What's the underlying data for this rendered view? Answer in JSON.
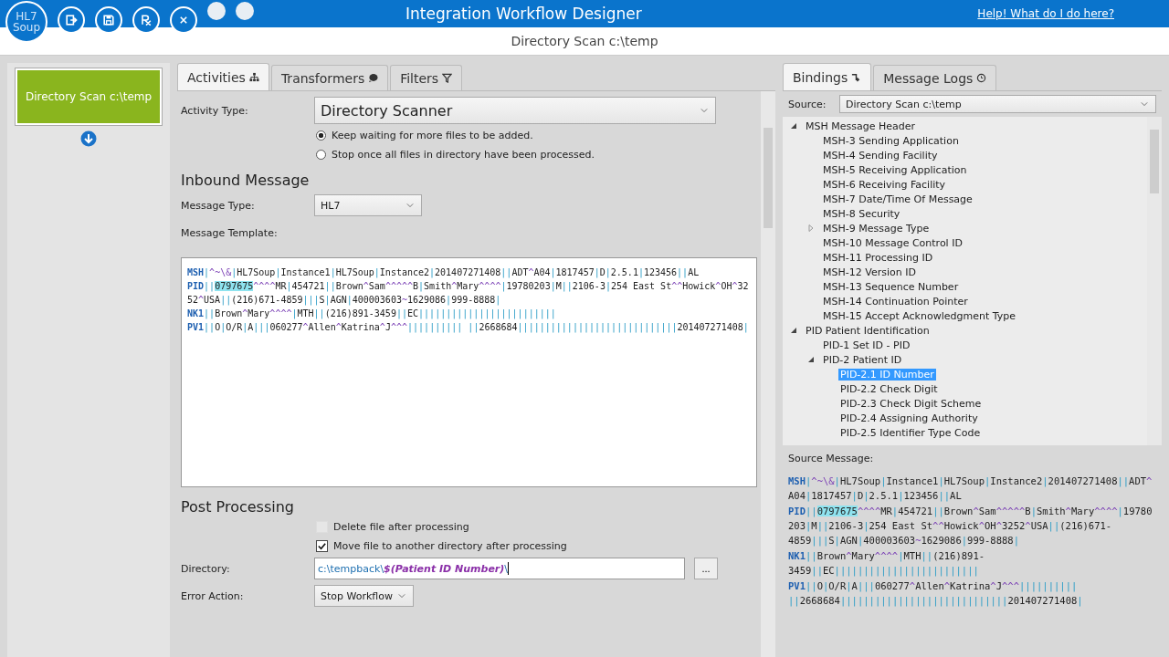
{
  "window": {
    "logo": [
      "HL7",
      "Soup"
    ],
    "title": "Integration Workflow Designer",
    "help_link": "Help!  What do I do here?",
    "subtitle": "Directory Scan c:\\temp",
    "toolbar": [
      {
        "kind": "exit",
        "disabled": false
      },
      {
        "kind": "save",
        "disabled": false
      },
      {
        "kind": "rx",
        "disabled": false
      },
      {
        "kind": "close",
        "disabled": false
      },
      {
        "kind": "blank",
        "disabled": true
      },
      {
        "kind": "blank",
        "disabled": true
      }
    ]
  },
  "workflow": {
    "activities": [
      {
        "label": "Directory Scan c:\\temp",
        "selected": true
      }
    ]
  },
  "editor": {
    "tabs": [
      {
        "label": "Activities",
        "selected": true
      },
      {
        "label": "Transformers",
        "selected": false
      },
      {
        "label": "Filters",
        "selected": false
      }
    ],
    "activity_type": {
      "label": "Activity Type:",
      "value": "Directory Scanner"
    },
    "scan_options": [
      {
        "label": "Keep waiting for more files to be added.",
        "selected": true
      },
      {
        "label": "Stop once all files in directory have been processed.",
        "selected": false
      }
    ],
    "inbound_heading": "Inbound Message",
    "message_type": {
      "label": "Message Type:",
      "value": "HL7"
    },
    "template_label": "Message Template:",
    "template": [
      {
        "name": "MSH",
        "parts": [
          {
            "kind": "text",
            "text": "|^~\\&|HL7Soup|Instance1|HL7Soup|Instance2|201407271408||ADT^A04|1817457|D|2.5.1|123456||AL"
          }
        ]
      },
      {
        "name": "PID",
        "parts": [
          {
            "kind": "text",
            "text": "||"
          },
          {
            "kind": "highlight",
            "text": "0797675"
          },
          {
            "kind": "text",
            "text": "^^^^MR|454721||Brown^Sam^^^^^B|Smith^Mary^^^^|19780203|M||2106-3|254 East St^^Howick^OH^3252^USA||(216)671-4859|||S|AGN|400003603~1629086|999-8888|"
          }
        ]
      },
      {
        "name": "NK1",
        "parts": [
          {
            "kind": "text",
            "text": "||Brown^Mary^^^^|MTH||(216)891-3459||EC|||||||||||||||||||||||||"
          }
        ]
      },
      {
        "name": "PV1",
        "parts": [
          {
            "kind": "text",
            "text": "||O|O/R|A|||060277^Allen^Katrina^J^^^|||||||||| ||2668684|||||||||||||||||||||||||||||201407271408|"
          }
        ]
      }
    ],
    "post_heading": "Post Processing",
    "post_options": [
      {
        "label": "Delete file after processing",
        "checked": false,
        "disabled": true
      },
      {
        "label": "Move file to another directory after processing",
        "checked": true,
        "disabled": false
      }
    ],
    "directory": {
      "label": "Directory:",
      "parts": [
        {
          "kind": "text",
          "text": "c:\\tempback\\"
        },
        {
          "kind": "variable",
          "text": "$(Patient ID Number)"
        },
        {
          "kind": "text",
          "text": "\\"
        }
      ],
      "browse": "..."
    },
    "error_action": {
      "label": "Error Action:",
      "value": "Stop Workflow"
    }
  },
  "bindings": {
    "tabs": [
      {
        "label": "Bindings",
        "selected": true
      },
      {
        "label": "Message Logs",
        "selected": false
      }
    ],
    "source": {
      "label": "Source:",
      "value": "Directory Scan c:\\temp"
    },
    "tree": [
      {
        "label": "MSH Message Header",
        "expanded": true,
        "selected": false,
        "children": [
          {
            "label": "MSH-3 Sending Application",
            "selected": false
          },
          {
            "label": "MSH-4 Sending Facility",
            "selected": false
          },
          {
            "label": "MSH-5 Receiving Application",
            "selected": false
          },
          {
            "label": "MSH-6 Receiving Facility",
            "selected": false
          },
          {
            "label": "MSH-7 Date/Time Of Message",
            "selected": false
          },
          {
            "label": "MSH-8 Security",
            "selected": false
          },
          {
            "label": "MSH-9 Message Type",
            "selected": false,
            "expanded": false
          },
          {
            "label": "MSH-10 Message Control ID",
            "selected": false
          },
          {
            "label": "MSH-11 Processing ID",
            "selected": false
          },
          {
            "label": "MSH-12 Version ID",
            "selected": false
          },
          {
            "label": "MSH-13 Sequence Number",
            "selected": false
          },
          {
            "label": "MSH-14 Continuation Pointer",
            "selected": false
          },
          {
            "label": "MSH-15 Accept Acknowledgment Type",
            "selected": false
          }
        ]
      },
      {
        "label": "PID Patient Identification",
        "expanded": true,
        "selected": false,
        "children": [
          {
            "label": "PID-1 Set ID - PID",
            "selected": false
          },
          {
            "label": "PID-2 Patient ID",
            "selected": false,
            "expanded": true,
            "children": [
              {
                "label": "PID-2.1 ID Number",
                "selected": true
              },
              {
                "label": "PID-2.2 Check Digit",
                "selected": false
              },
              {
                "label": "PID-2.3 Check Digit Scheme",
                "selected": false
              },
              {
                "label": "PID-2.4 Assigning Authority",
                "selected": false
              },
              {
                "label": "PID-2.5 Identifier Type Code",
                "selected": false
              }
            ]
          }
        ]
      }
    ],
    "source_label": "Source Message:",
    "source_message": [
      {
        "name": "MSH",
        "parts": [
          {
            "kind": "text",
            "text": "|^~\\&|HL7Soup|Instance1|HL7Soup|Instance2|201407271408||ADT^A04|1817457|D|2.5.1|123456||AL"
          }
        ]
      },
      {
        "name": "PID",
        "parts": [
          {
            "kind": "text",
            "text": "||"
          },
          {
            "kind": "highlight",
            "text": "0797675"
          },
          {
            "kind": "text",
            "text": "^^^^MR|454721||Brown^Sam^^^^^B|Smith^Mary^^^^|19780203|M||2106-3|254 East St^^Howick^OH^3252^USA||(216)671-4859|||S|AGN|400003603~1629086|999-8888|"
          }
        ]
      },
      {
        "name": "NK1",
        "parts": [
          {
            "kind": "text",
            "text": "||Brown^Mary^^^^|MTH||(216)891-3459||EC|||||||||||||||||||||||||"
          }
        ]
      },
      {
        "name": "PV1",
        "parts": [
          {
            "kind": "text",
            "text": "||O|O/R|A|||060277^Allen^Katrina^J^^^|||||||||| ||2668684|||||||||||||||||||||||||||||201407271408|"
          }
        ]
      }
    ]
  }
}
